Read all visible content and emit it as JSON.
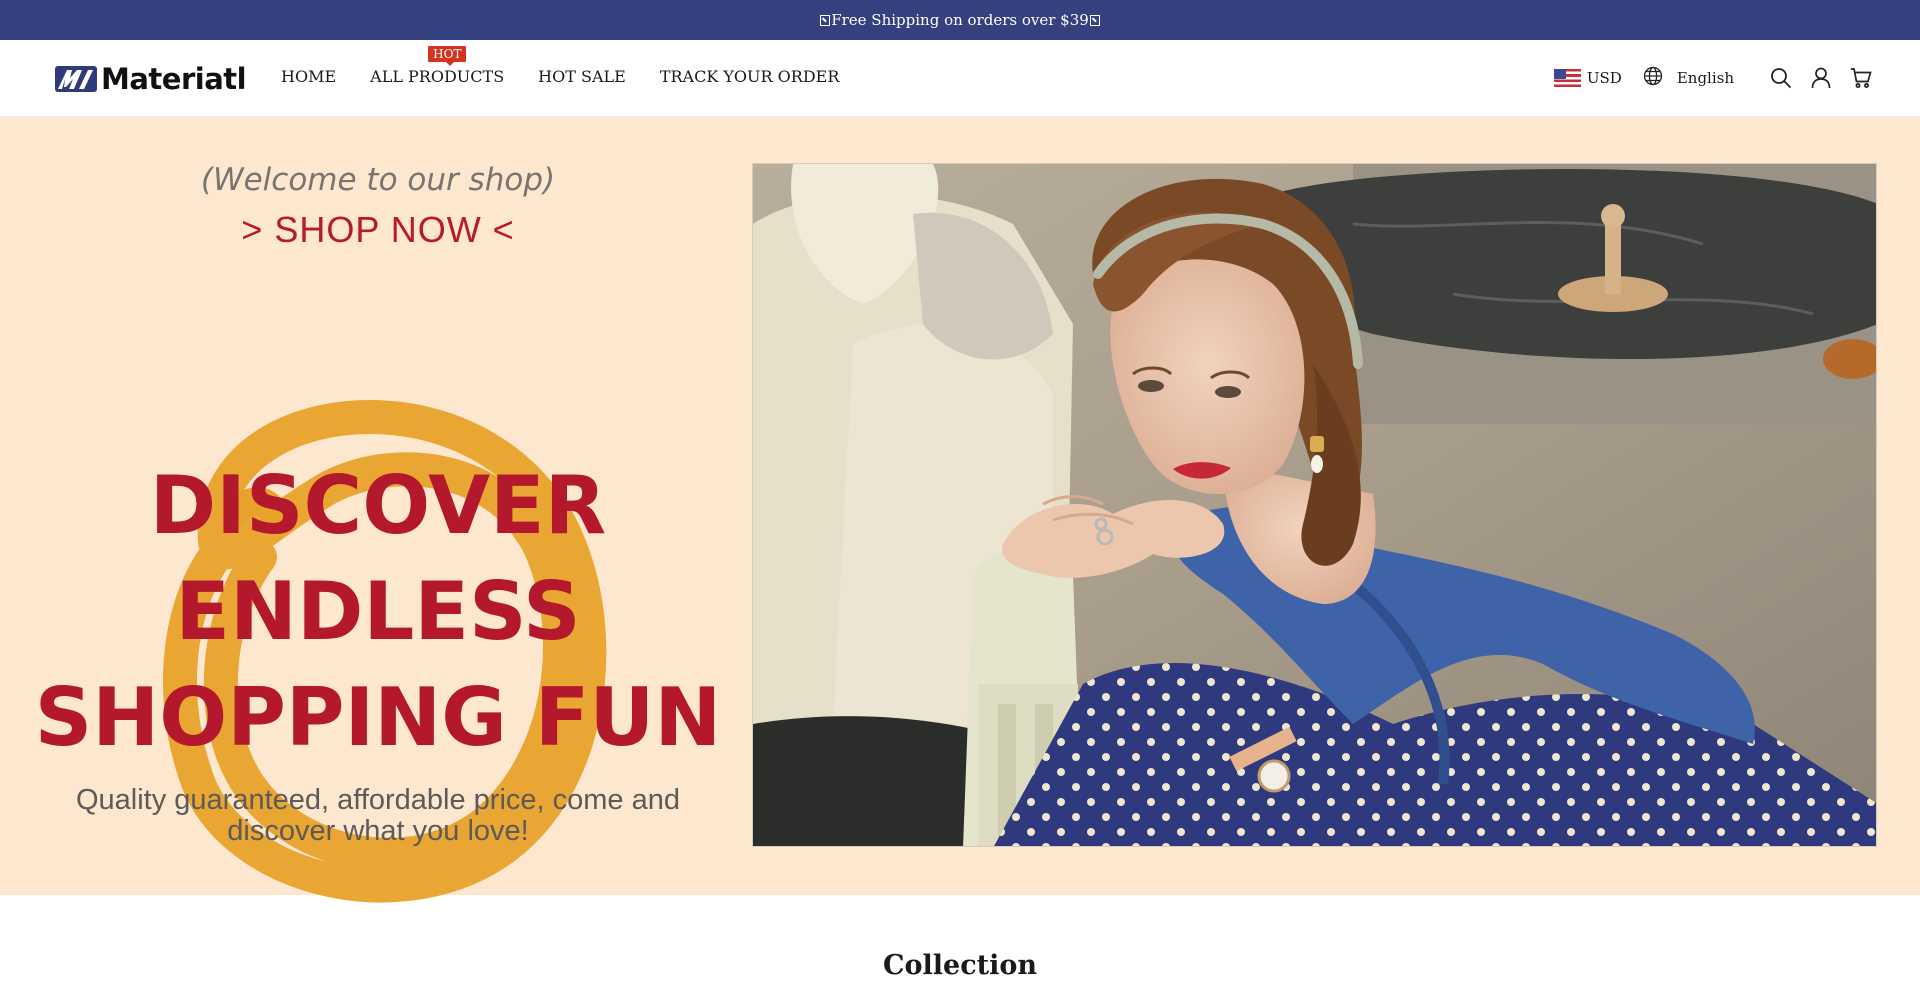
{
  "announcement": {
    "text": "Free Shipping on orders over $39"
  },
  "header": {
    "logo_text": "Materiatl",
    "nav": [
      {
        "label": "HOME"
      },
      {
        "label": "ALL PRODUCTS",
        "badge": "HOT"
      },
      {
        "label": "HOT SALE"
      },
      {
        "label": "TRACK YOUR ORDER"
      }
    ],
    "currency": "USD",
    "language": "English",
    "icons": [
      "globe-icon",
      "search-icon",
      "account-icon",
      "cart-icon"
    ]
  },
  "hero": {
    "welcome": "(Welcome to our shop)",
    "shop_now": "> SHOP NOW <",
    "headline": [
      "DISCOVER",
      "ENDLESS",
      "SHOPPING FUN"
    ],
    "subline": "Quality guaranteed, affordable price, come and discover what you love!"
  },
  "collection": {
    "title": "Collection"
  },
  "colors": {
    "announcement_bg": "#35407f",
    "hero_bg": "#fde7cf",
    "headline": "#b3182c",
    "scribble": "#e8a22a",
    "hot_badge": "#d4341f"
  }
}
